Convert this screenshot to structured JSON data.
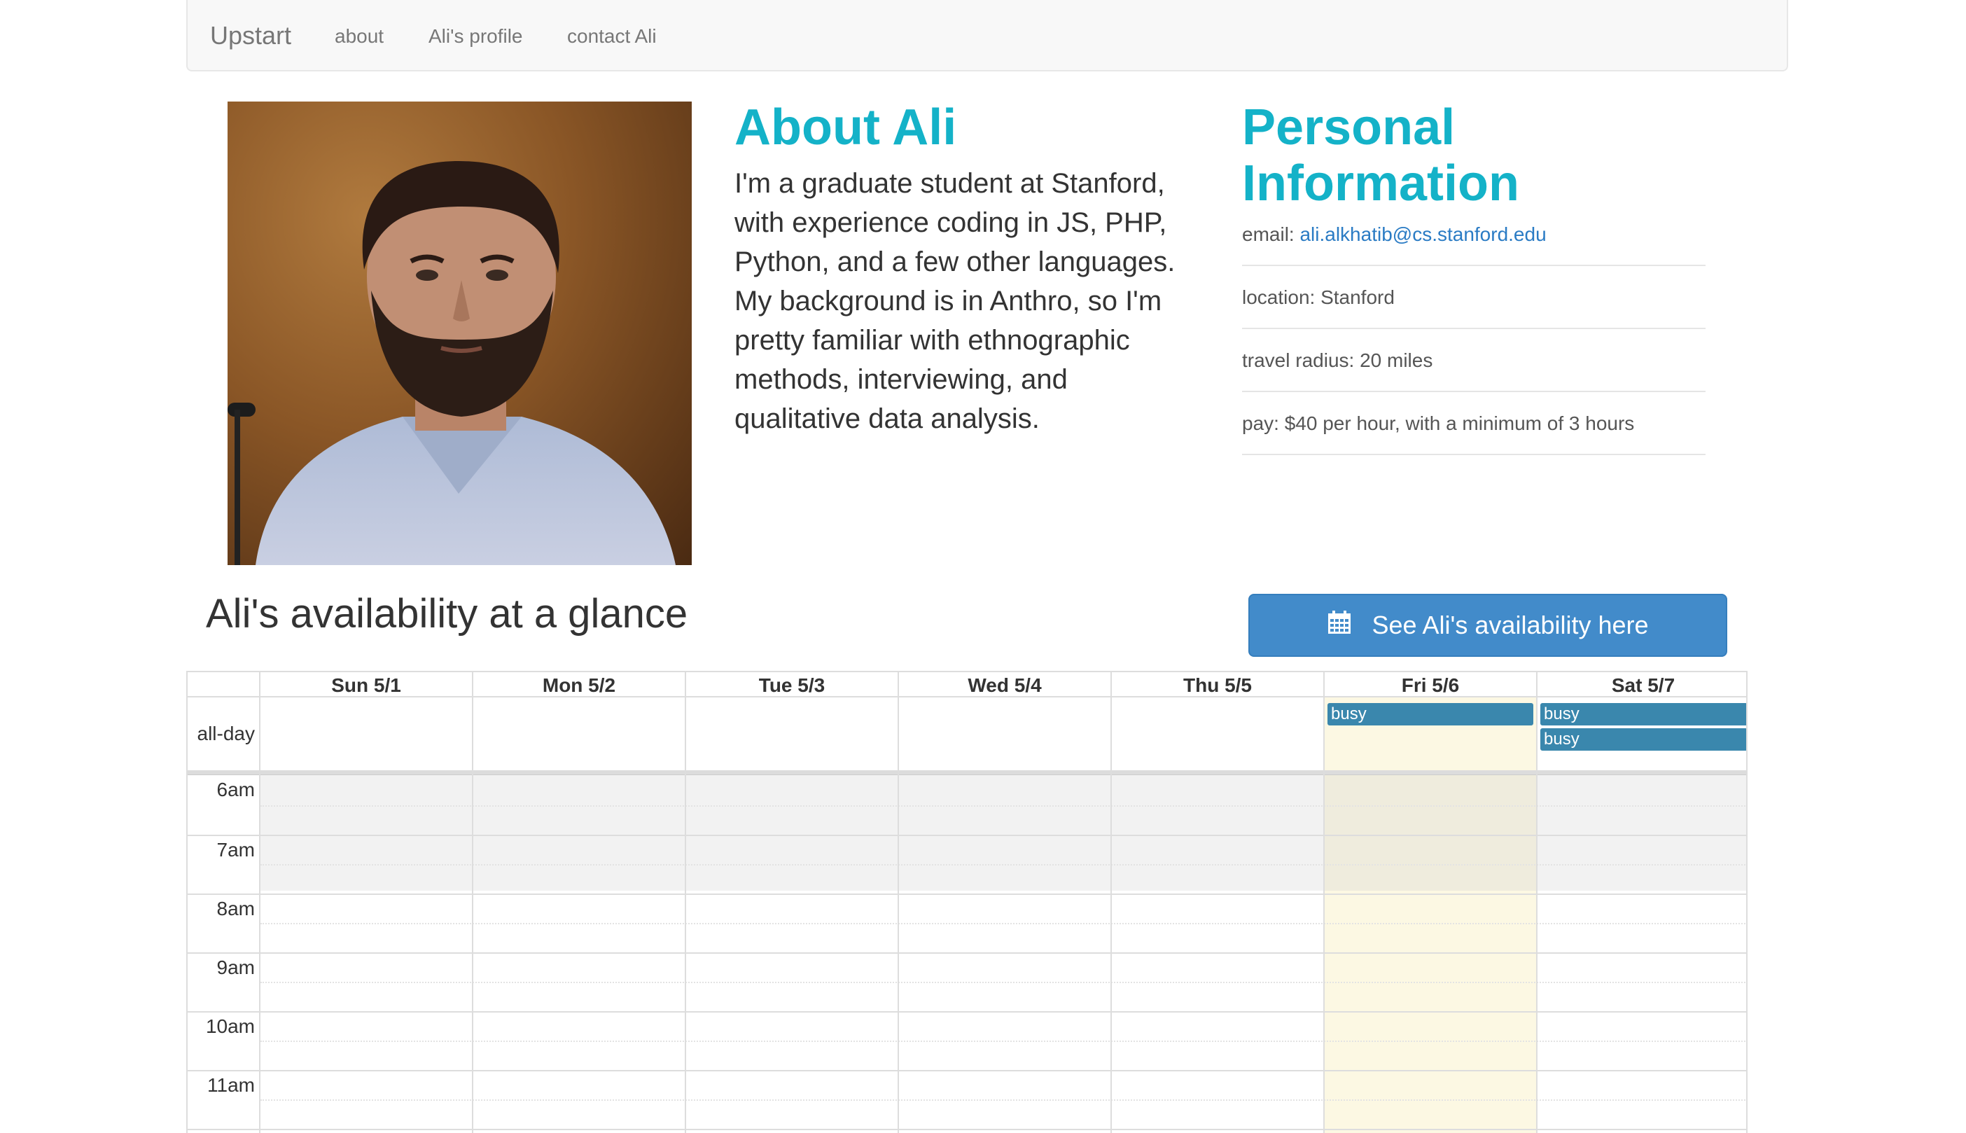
{
  "navbar": {
    "brand": "Upstart",
    "links": [
      "about",
      "Ali's profile",
      "contact Ali"
    ]
  },
  "about": {
    "heading": "About Ali",
    "text": "I'm a graduate student at Stanford, with experience coding in JS, PHP, Python, and a few other languages. My background is in Anthro, so I'm pretty familiar with ethnographic methods, interviewing, and qualitative data analysis."
  },
  "personal": {
    "heading_line1": "Personal",
    "heading_line2": "Information",
    "email_label": "email: ",
    "email": "ali.alkhatib@cs.stanford.edu",
    "location": "location: Stanford",
    "travel": "travel radius: 20 miles",
    "pay": "pay: $40 per hour, with a minimum of 3 hours"
  },
  "availability": {
    "title": "Ali's availability at a glance",
    "button_label": "See Ali's availability here",
    "button_icon": "calendar-icon"
  },
  "calendar": {
    "days": [
      "Sun 5/1",
      "Mon 5/2",
      "Tue 5/3",
      "Wed 5/4",
      "Thu 5/5",
      "Fri 5/6",
      "Sat 5/7"
    ],
    "all_day_label": "all-day",
    "times": [
      "6am",
      "7am",
      "8am",
      "9am",
      "10am",
      "11am"
    ],
    "events": [
      {
        "day": "Fri 5/6",
        "label": "busy",
        "all_day": true
      },
      {
        "day": "Sat 5/7",
        "label": "busy",
        "all_day": true
      },
      {
        "day": "Sat 5/7",
        "label": "busy",
        "all_day": true
      }
    ],
    "today": "Fri 5/6",
    "colors": {
      "event": "#3a87ad",
      "today": "#fcf8e3",
      "off_hours": "#f2f2f2"
    }
  }
}
